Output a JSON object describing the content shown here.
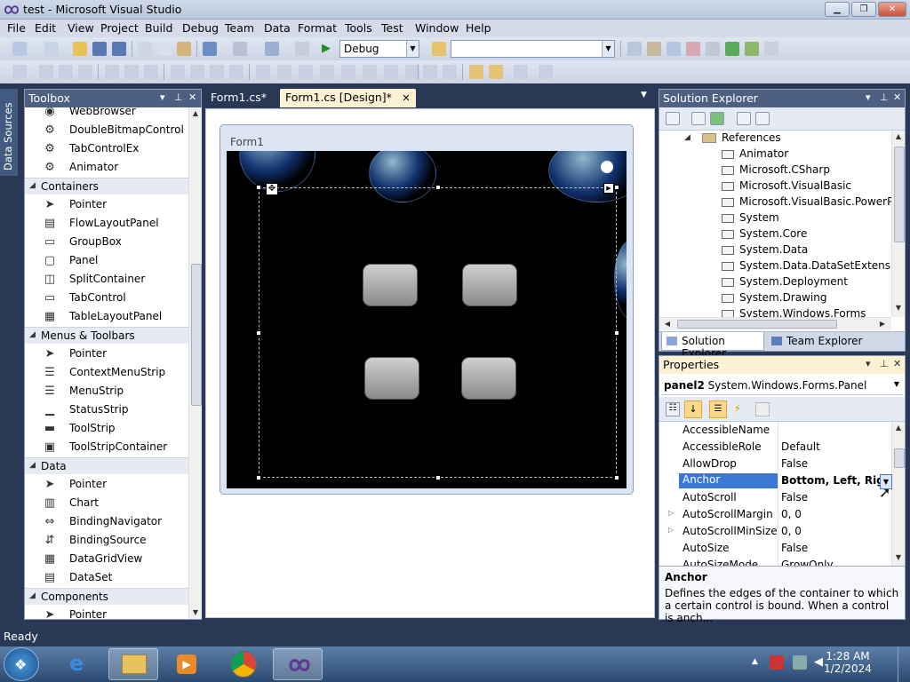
{
  "window": {
    "title": "test - Microsoft Visual Studio",
    "minimize": "▁",
    "maximize": "❐",
    "close": "✕"
  },
  "menu": [
    "File",
    "Edit",
    "View",
    "Project",
    "Build",
    "Debug",
    "Team",
    "Data",
    "Format",
    "Tools",
    "Test",
    "Window",
    "Help"
  ],
  "toolbar": {
    "config": "Debug",
    "platform": ""
  },
  "data_sources_tab": "Data Sources",
  "toolbox": {
    "title": "Toolbox",
    "items": [
      {
        "type": "item",
        "icon": "web-browser-icon",
        "glyph": "◉",
        "label": "WebBrowser"
      },
      {
        "type": "item",
        "icon": "gear-icon",
        "glyph": "⚙",
        "label": "DoubleBitmapControl"
      },
      {
        "type": "item",
        "icon": "gear-icon",
        "glyph": "⚙",
        "label": "TabControlEx"
      },
      {
        "type": "item",
        "icon": "gear-icon",
        "glyph": "⚙",
        "label": "Animator"
      },
      {
        "type": "category",
        "label": "Containers"
      },
      {
        "type": "item",
        "icon": "pointer-icon",
        "glyph": "➤",
        "label": "Pointer"
      },
      {
        "type": "item",
        "icon": "flow-layout-icon",
        "glyph": "▤",
        "label": "FlowLayoutPanel"
      },
      {
        "type": "item",
        "icon": "group-box-icon",
        "glyph": "▭",
        "label": "GroupBox"
      },
      {
        "type": "item",
        "icon": "panel-icon",
        "glyph": "▢",
        "label": "Panel"
      },
      {
        "type": "item",
        "icon": "split-container-icon",
        "glyph": "◫",
        "label": "SplitContainer"
      },
      {
        "type": "item",
        "icon": "tab-control-icon",
        "glyph": "▭",
        "label": "TabControl"
      },
      {
        "type": "item",
        "icon": "table-layout-icon",
        "glyph": "▦",
        "label": "TableLayoutPanel"
      },
      {
        "type": "category",
        "label": "Menus & Toolbars"
      },
      {
        "type": "item",
        "icon": "pointer-icon",
        "glyph": "➤",
        "label": "Pointer"
      },
      {
        "type": "item",
        "icon": "context-menu-icon",
        "glyph": "☰",
        "label": "ContextMenuStrip"
      },
      {
        "type": "item",
        "icon": "menu-strip-icon",
        "glyph": "☰",
        "label": "MenuStrip"
      },
      {
        "type": "item",
        "icon": "status-strip-icon",
        "glyph": "▁",
        "label": "StatusStrip"
      },
      {
        "type": "item",
        "icon": "tool-strip-icon",
        "glyph": "▬",
        "label": "ToolStrip"
      },
      {
        "type": "item",
        "icon": "tool-strip-container-icon",
        "glyph": "▣",
        "label": "ToolStripContainer"
      },
      {
        "type": "category",
        "label": "Data"
      },
      {
        "type": "item",
        "icon": "pointer-icon",
        "glyph": "➤",
        "label": "Pointer"
      },
      {
        "type": "item",
        "icon": "chart-icon",
        "glyph": "▥",
        "label": "Chart"
      },
      {
        "type": "item",
        "icon": "binding-navigator-icon",
        "glyph": "⇔",
        "label": "BindingNavigator"
      },
      {
        "type": "item",
        "icon": "binding-source-icon",
        "glyph": "⇵",
        "label": "BindingSource"
      },
      {
        "type": "item",
        "icon": "data-grid-view-icon",
        "glyph": "▦",
        "label": "DataGridView"
      },
      {
        "type": "item",
        "icon": "data-set-icon",
        "glyph": "▤",
        "label": "DataSet"
      },
      {
        "type": "category",
        "label": "Components"
      },
      {
        "type": "item",
        "icon": "pointer-icon",
        "glyph": "➤",
        "label": "Pointer"
      }
    ]
  },
  "tabs": [
    {
      "label": "Form1.cs*",
      "active": false
    },
    {
      "label": "Form1.cs [Design]*",
      "active": true
    }
  ],
  "form": {
    "title": "Form1"
  },
  "solution_explorer": {
    "title": "Solution Explorer",
    "references_label": "References",
    "references": [
      "Animator",
      "Microsoft.CSharp",
      "Microsoft.VisualBasic",
      "Microsoft.VisualBasic.PowerPacks",
      "System",
      "System.Core",
      "System.Data",
      "System.Data.DataSetExtensions",
      "System.Deployment",
      "System.Drawing",
      "System.Windows.Forms"
    ],
    "bottom_tabs": [
      "Solution Explorer",
      "Team Explorer"
    ]
  },
  "properties": {
    "title": "Properties",
    "object_name": "panel2",
    "object_type": "System.Windows.Forms.Panel",
    "rows": [
      {
        "name": "AccessibleName",
        "value": "",
        "expandable": false,
        "selected": false
      },
      {
        "name": "AccessibleRole",
        "value": "Default",
        "expandable": false,
        "selected": false
      },
      {
        "name": "AllowDrop",
        "value": "False",
        "expandable": false,
        "selected": false
      },
      {
        "name": "Anchor",
        "value": "Bottom, Left, Righ",
        "expandable": false,
        "selected": true
      },
      {
        "name": "AutoScroll",
        "value": "False",
        "expandable": false,
        "selected": false
      },
      {
        "name": "AutoScrollMargin",
        "value": "0, 0",
        "expandable": true,
        "selected": false
      },
      {
        "name": "AutoScrollMinSize",
        "value": "0, 0",
        "expandable": true,
        "selected": false
      },
      {
        "name": "AutoSize",
        "value": "False",
        "expandable": false,
        "selected": false
      },
      {
        "name": "AutoSizeMode",
        "value": "GrowOnly",
        "expandable": false,
        "selected": false
      }
    ],
    "desc_title": "Anchor",
    "desc_text": "Defines the edges of the container to which a certain control is bound. When a control is anch..."
  },
  "status": "Ready",
  "clock": {
    "time": "1:28 AM",
    "date": "1/2/2024"
  }
}
